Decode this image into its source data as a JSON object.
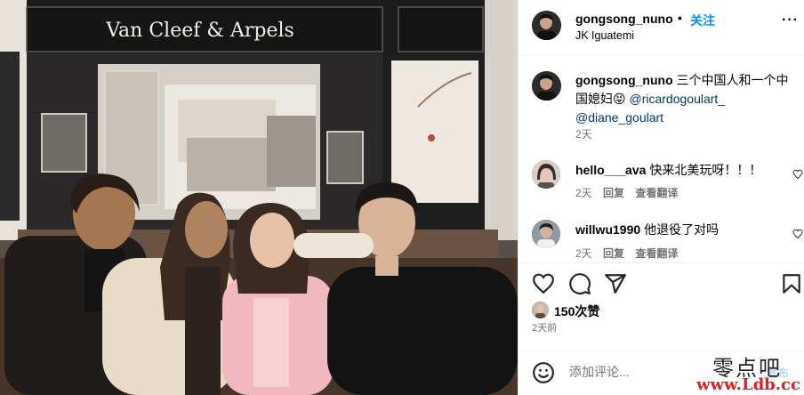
{
  "store_sign": "Van Cleef & Arpels",
  "post": {
    "author": "gongsong_nuno",
    "separator": "•",
    "follow_label": "关注",
    "location": "JK Iguatemi",
    "more_label": "···"
  },
  "caption": {
    "author": "gongsong_nuno",
    "text": "三个中国人和一个中国媳妇😝",
    "mention1": "@ricardogoulart_",
    "mention2": "@diane_goulart",
    "time": "2天"
  },
  "comments": [
    {
      "author": "hello___ava",
      "text": "快来北美玩呀！！！",
      "time": "2天",
      "reply": "回复",
      "translate": "查看翻译"
    },
    {
      "author": "willwu1990",
      "text": "他退役了对吗",
      "time": "2天",
      "reply": "回复",
      "translate": "查看翻译"
    }
  ],
  "likes": {
    "count_label": "150次赞"
  },
  "post_time": "2天前",
  "comment_input": {
    "placeholder": "添加评论...",
    "post_label": "发布"
  },
  "watermark": {
    "line1": "零点吧",
    "line2": "www.Ldb.cc"
  },
  "colors": {
    "link": "#0095f6",
    "mention": "#00376b",
    "muted": "#737373",
    "watermark_red": "#e0211d"
  }
}
